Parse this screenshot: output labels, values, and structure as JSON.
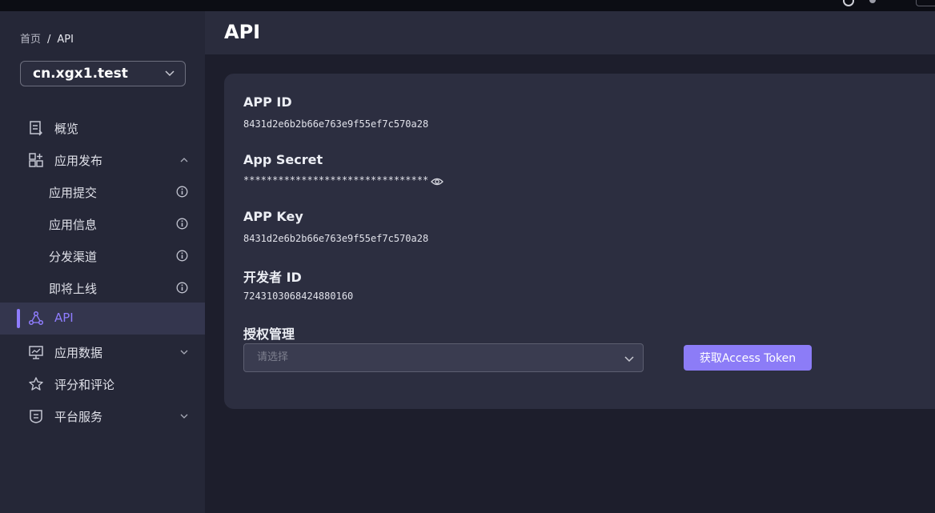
{
  "breadcrumb": {
    "home": "首页",
    "separator": "/",
    "current": "API"
  },
  "app_selector": {
    "value": "cn.xgx1.test",
    "icon": "chevron-down-icon"
  },
  "sidebar": {
    "items": [
      {
        "label": "概览",
        "icon": "document-icon"
      },
      {
        "label": "应用发布",
        "icon": "grid-apps-icon",
        "expanded": true
      },
      {
        "label": "应用提交",
        "icon": "info-icon"
      },
      {
        "label": "应用信息",
        "icon": "info-icon"
      },
      {
        "label": "分发渠道",
        "icon": "info-icon"
      },
      {
        "label": "即将上线",
        "icon": "info-icon"
      },
      {
        "label": "API",
        "icon": "api-nodes-icon",
        "active": true
      },
      {
        "label": "应用数据",
        "icon": "monitor-chart-icon",
        "expanded": false
      },
      {
        "label": "评分和评论",
        "icon": "star-icon"
      },
      {
        "label": "平台服务",
        "icon": "shield-icon",
        "expanded": false
      }
    ]
  },
  "page": {
    "title": "API"
  },
  "fields": {
    "app_id": {
      "label": "APP ID",
      "value": "8431d2e6b2b66e763e9f55ef7c570a28"
    },
    "app_secret": {
      "label": "App Secret",
      "value": "********************************",
      "icon": "eye-icon"
    },
    "app_key": {
      "label": "APP Key",
      "value": "8431d2e6b2b66e763e9f55ef7c570a28"
    },
    "developer_id": {
      "label": "开发者 ID",
      "value": "7243103068424880160"
    },
    "auth": {
      "label": "授权管理",
      "placeholder": "请选择",
      "button": "获取Access Token"
    }
  },
  "colors": {
    "accent": "#8c7cf7",
    "sidebar_bg": "#252737",
    "card_bg": "#2c2e40",
    "page_bg": "#1d1e2c"
  }
}
